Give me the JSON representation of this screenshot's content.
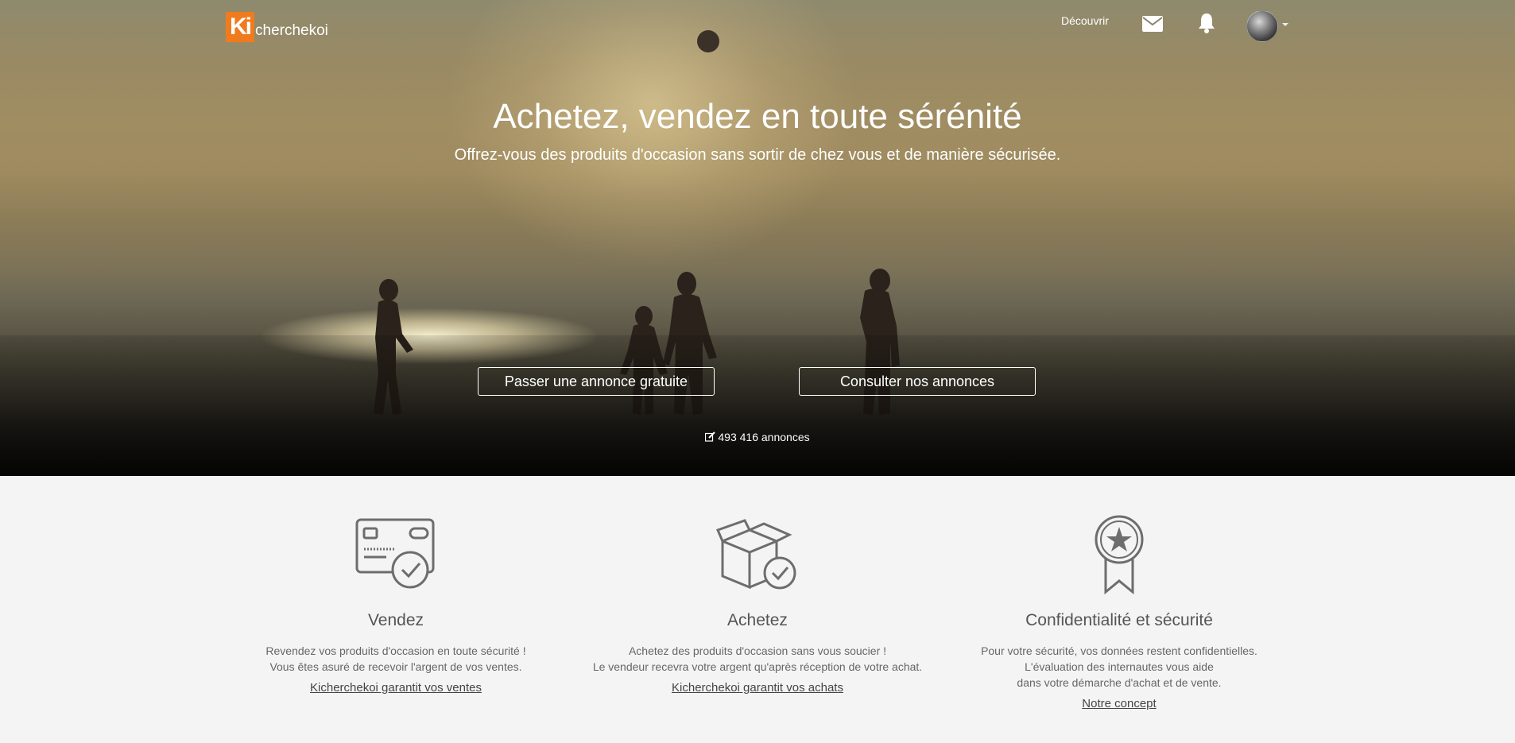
{
  "brand": {
    "logo_mark": "Ki",
    "logo_text": "cherchekoi"
  },
  "nav": {
    "discover_label": "Découvrir",
    "icons": [
      "envelope-icon",
      "bell-icon",
      "avatar"
    ]
  },
  "hero": {
    "title": "Achetez, vendez en toute sérénité",
    "subtitle": "Offrez-vous des produits d'occasion sans sortir de chez vous et de manière sécurisée.",
    "post_button_label": "Passer une annonce gratuite",
    "browse_button_label": "Consulter nos annonces",
    "ad_count_label": "493 416 annonces"
  },
  "features": [
    {
      "icon": "credit-card-check-icon",
      "title": "Vendez",
      "lines": [
        "Revendez vos produits d'occasion en toute sécurité !",
        "Vous êtes asuré de recevoir l'argent de vos ventes."
      ],
      "link": "Kicherchekoi garantit vos ventes"
    },
    {
      "icon": "box-check-icon",
      "title": "Achetez",
      "lines": [
        "Achetez des produits d'occasion sans vous soucier !",
        "Le vendeur recevra votre argent qu'après réception de votre achat."
      ],
      "link": "Kicherchekoi garantit vos achats"
    },
    {
      "icon": "award-ribbon-icon",
      "title": "Confidentialité et sécurité",
      "lines": [
        "Pour votre sécurité, vos données restent confidentielles.",
        "L'évaluation des internautes vous aide",
        "dans votre démarche d'achat et de vente."
      ],
      "link": "Notre concept"
    }
  ],
  "colors": {
    "brand_orange": "#f07b1d",
    "text_gray": "#5c5c5c",
    "section_bg": "#f4f4f4"
  }
}
